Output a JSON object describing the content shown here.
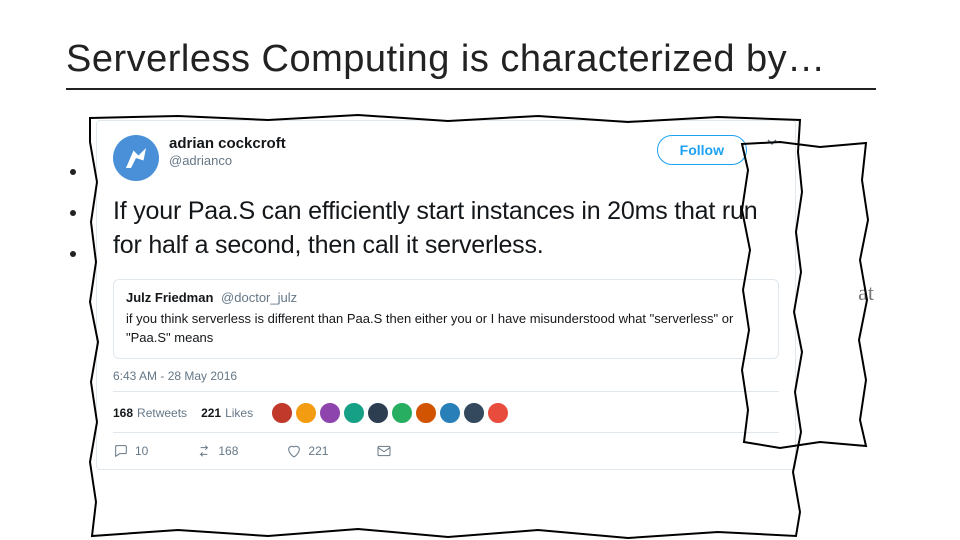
{
  "title": "Serverless Computing is characterized by…",
  "peek_text": "at",
  "tweet": {
    "display_name": "adrian cockcroft",
    "handle": "@adrianco",
    "follow_label": "Follow",
    "body": "If your Paa.S can efficiently start instances in 20ms that run for half a second, then call it serverless.",
    "quote": {
      "name": "Julz Friedman",
      "handle": "@doctor_julz",
      "body": "if you think serverless is different than Paa.S then either you or I have misunderstood what \"serverless\" or \"Paa.S\" means"
    },
    "timestamp": "6:43 AM - 28 May 2016",
    "retweets_count": "168",
    "retweets_label": "Retweets",
    "likes_count": "221",
    "likes_label": "Likes",
    "actions": {
      "reply_count": "10",
      "retweet_count": "168",
      "like_count": "221"
    }
  }
}
